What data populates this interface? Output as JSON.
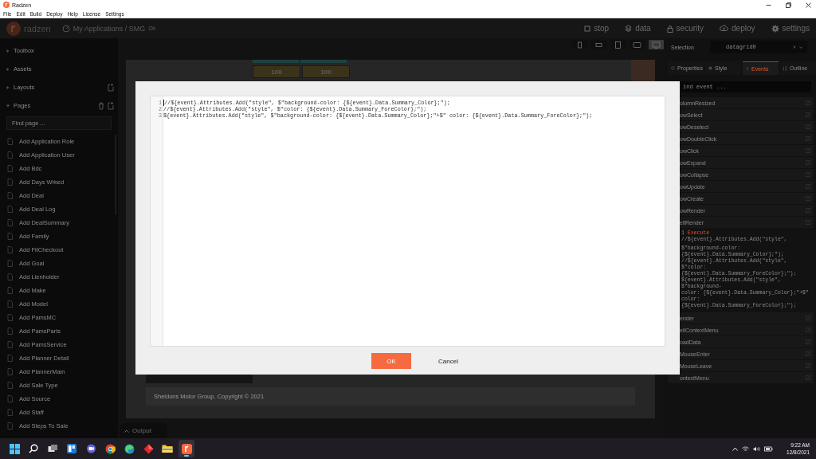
{
  "window": {
    "title": "Radzen"
  },
  "menu": [
    "File",
    "Edit",
    "Build",
    "Deploy",
    "Help",
    "License",
    "Settings"
  ],
  "header": {
    "logo": "radzen",
    "breadcrumb": "My Applications / SMG",
    "actions": [
      {
        "label": "stop",
        "kind": "stop"
      },
      {
        "label": "data",
        "kind": "data"
      },
      {
        "label": "security",
        "kind": "security"
      },
      {
        "label": "deploy",
        "kind": "deploy"
      },
      {
        "label": "settings",
        "kind": "settings"
      }
    ]
  },
  "sidebar": {
    "sections": [
      {
        "label": "Toolbox",
        "expanded": false,
        "addable": false,
        "deletable": false
      },
      {
        "label": "Assets",
        "expanded": false,
        "addable": false,
        "deletable": false
      },
      {
        "label": "Layouts",
        "expanded": false,
        "addable": true,
        "deletable": false
      },
      {
        "label": "Pages",
        "expanded": true,
        "addable": true,
        "deletable": true
      }
    ],
    "search": {
      "placeholder": "Find page ..."
    },
    "pages": [
      "Add Application Role",
      "Add Application User",
      "Add Bdc",
      "Add Days Wrked",
      "Add Deal",
      "Add Deal Log",
      "Add DealSummary",
      "Add Family",
      "Add FitCheckout",
      "Add Goal",
      "Add Lienholder",
      "Add Make",
      "Add Model",
      "Add PamsMC",
      "Add PamsParts",
      "Add PamsService",
      "Add Planner Detail",
      "Add PlannerMain",
      "Add Sale Type",
      "Add Source",
      "Add Staff",
      "Add Steps To Sale"
    ]
  },
  "devices": [
    {
      "kind": "phone",
      "selected": false
    },
    {
      "kind": "phone-landscape",
      "selected": false
    },
    {
      "kind": "tablet",
      "selected": false
    },
    {
      "kind": "laptop",
      "selected": false
    },
    {
      "kind": "desktop",
      "selected": true
    }
  ],
  "canvas": {
    "cells": [
      "100",
      "100"
    ],
    "footer": "Sheldons Motor Group, Copyright © 2021"
  },
  "output": {
    "label": "Output"
  },
  "inspector": {
    "selection_label": "Selection",
    "selection_value": "datagrid0",
    "tabs": [
      {
        "label": "Properties",
        "kind": "properties",
        "selected": false
      },
      {
        "label": "Style",
        "kind": "style",
        "selected": false
      },
      {
        "label": "Events",
        "kind": "events",
        "selected": true
      },
      {
        "label": "Outline",
        "kind": "outline",
        "selected": false
      }
    ],
    "search": {
      "placeholder": "ind event ..."
    },
    "events": [
      {
        "name": "olumnResized"
      },
      {
        "name": "owSelect"
      },
      {
        "name": "owDeselect"
      },
      {
        "name": "owDoubleClick"
      },
      {
        "name": "owClick"
      },
      {
        "name": "owExpand"
      },
      {
        "name": "owCollapse"
      },
      {
        "name": "owUpdate"
      },
      {
        "name": "owCreate"
      },
      {
        "name": "owRender"
      },
      {
        "name": "ellRender",
        "code": {
          "number": "1",
          "keyword": "Execute",
          "first": "//${event}.Attributes.Add(\"style\",",
          "lines": [
            "$\"background-color:",
            "{${event}.Data.Summary_Color};\");",
            "//${event}.Attributes.Add(\"style\", $\"color:",
            "{${event}.Data.Summary_ForeColor};\");",
            "${event}.Attributes.Add(\"style\", $\"background-",
            "color: {${event}.Data.Summary_Color};\"+$\"",
            "color: {${event}.Data.Summary_ForeColor};\");"
          ]
        }
      },
      {
        "name": "ender"
      },
      {
        "name": "ellContextMenu"
      },
      {
        "name": "oadData"
      },
      {
        "name": "MouseEnter"
      },
      {
        "name": "MouseLeave"
      },
      {
        "name": "ontextMenu"
      }
    ]
  },
  "dialog": {
    "lines": [
      {
        "number": "1",
        "text": "//${event}.Attributes.Add(\"style\", $\"background-color: {${event}.Data.Summary_Color};\");"
      },
      {
        "number": "2",
        "text": "//${event}.Attributes.Add(\"style\", $\"color: {${event}.Data.Summary_ForeColor};\");"
      },
      {
        "number": "3",
        "text": "${event}.Attributes.Add(\"style\", $\"background-color: {${event}.Data.Summary_Color};\"+$\" color: {${event}.Data.Summary_ForeColor};\");"
      }
    ],
    "buttons": [
      {
        "label": "OK",
        "kind": "primary"
      },
      {
        "label": "Cancel",
        "kind": "link"
      }
    ]
  },
  "taskbar": {
    "apps": [
      {
        "kind": "start",
        "active": false
      },
      {
        "kind": "search",
        "active": false
      },
      {
        "kind": "task-view",
        "active": false
      },
      {
        "kind": "widgets",
        "active": false
      },
      {
        "kind": "chat",
        "active": false
      },
      {
        "kind": "chrome",
        "active": false
      },
      {
        "kind": "edge",
        "active": false
      },
      {
        "kind": "diamond",
        "active": false
      },
      {
        "kind": "folder",
        "active": false
      },
      {
        "kind": "radzen",
        "active": true
      }
    ],
    "time": "9:22 AM",
    "date": "12/8/2021"
  }
}
